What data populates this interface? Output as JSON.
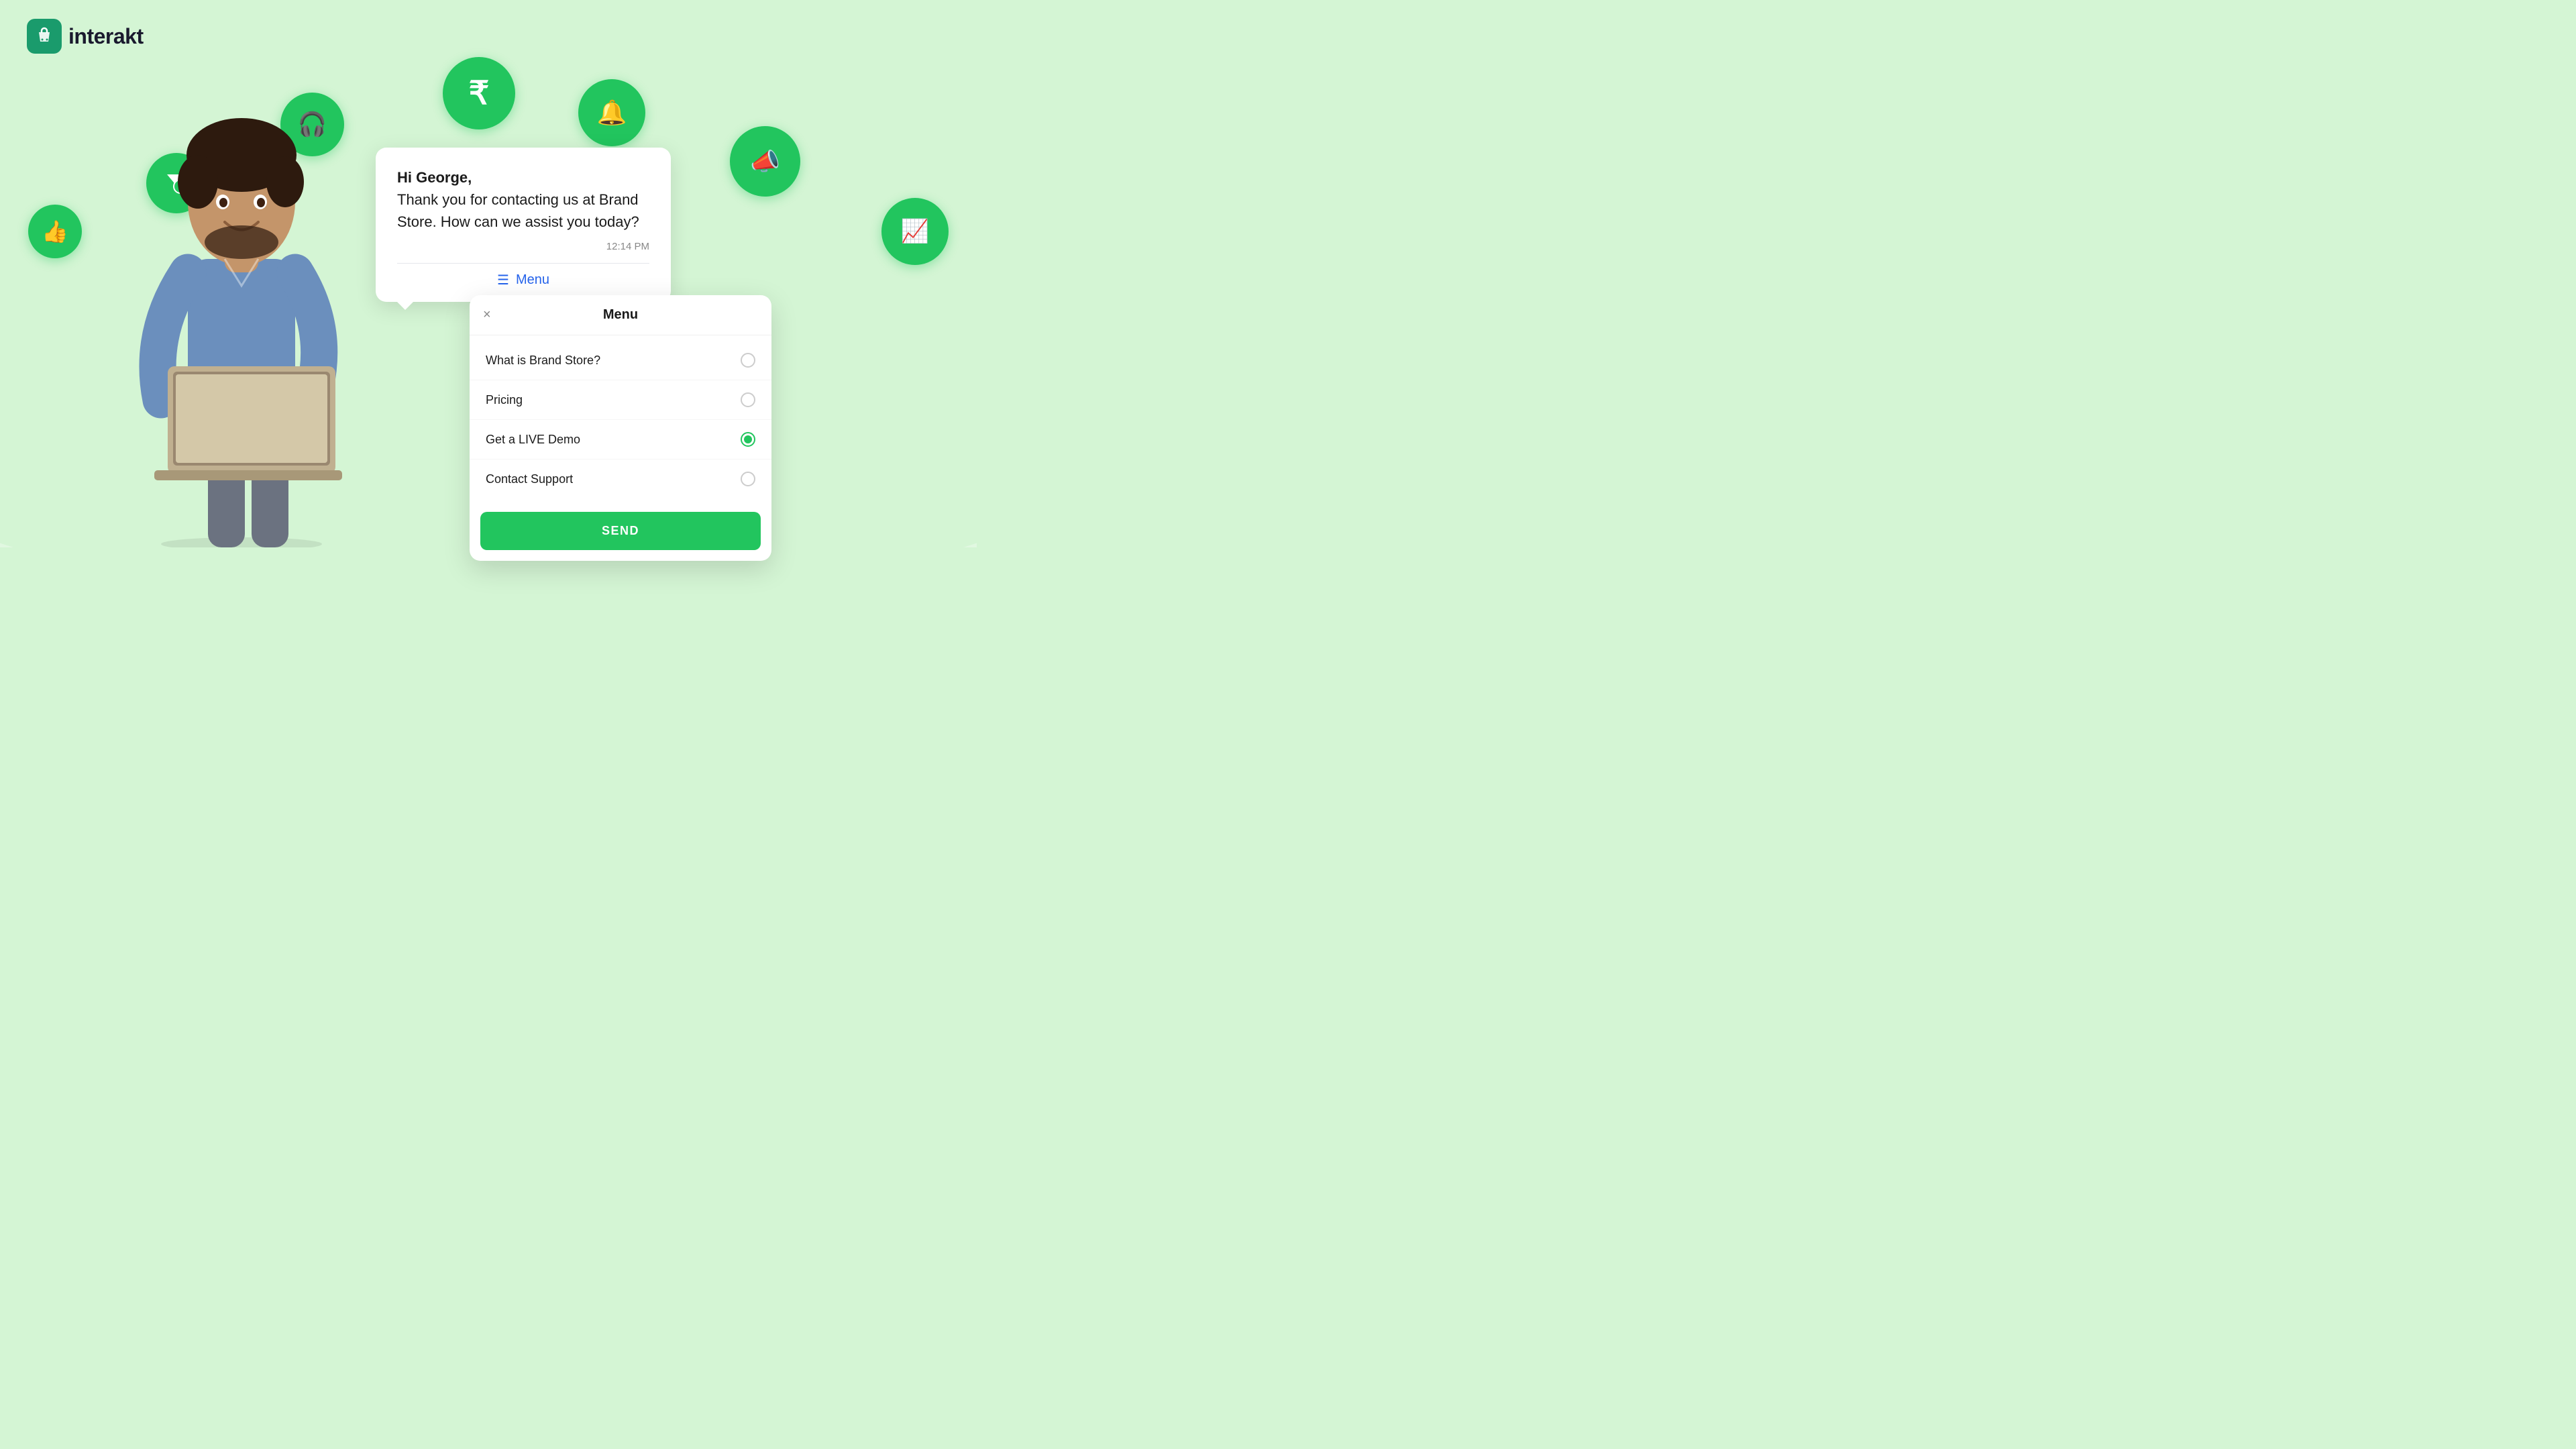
{
  "logo": {
    "text": "interakt",
    "icon_label": "shopping-bag"
  },
  "background": {
    "color": "#d4f5d4"
  },
  "bubbles": [
    {
      "id": "thumbs",
      "icon": "👍",
      "label": "thumbs-up-icon"
    },
    {
      "id": "filter",
      "icon": "💰",
      "label": "filter-money-icon"
    },
    {
      "id": "headset",
      "icon": "🎧",
      "label": "headset-icon"
    },
    {
      "id": "rupee",
      "icon": "₹",
      "label": "rupee-icon"
    },
    {
      "id": "bell",
      "icon": "🔔",
      "label": "bell-icon"
    },
    {
      "id": "megaphone",
      "icon": "📣",
      "label": "megaphone-icon"
    },
    {
      "id": "chart",
      "icon": "📈",
      "label": "chart-icon"
    }
  ],
  "chat": {
    "greeting": "Hi George,",
    "message": "Thank you for contacting us at Brand Store. How can we assist you today?",
    "time": "12:14 PM",
    "menu_label": "Menu"
  },
  "menu": {
    "title": "Menu",
    "close_label": "×",
    "items": [
      {
        "label": "What is Brand Store?",
        "selected": false
      },
      {
        "label": "Pricing",
        "selected": false
      },
      {
        "label": "Get a LIVE Demo",
        "selected": true
      },
      {
        "label": "Contact Support",
        "selected": false
      }
    ],
    "send_button": "SEND"
  }
}
